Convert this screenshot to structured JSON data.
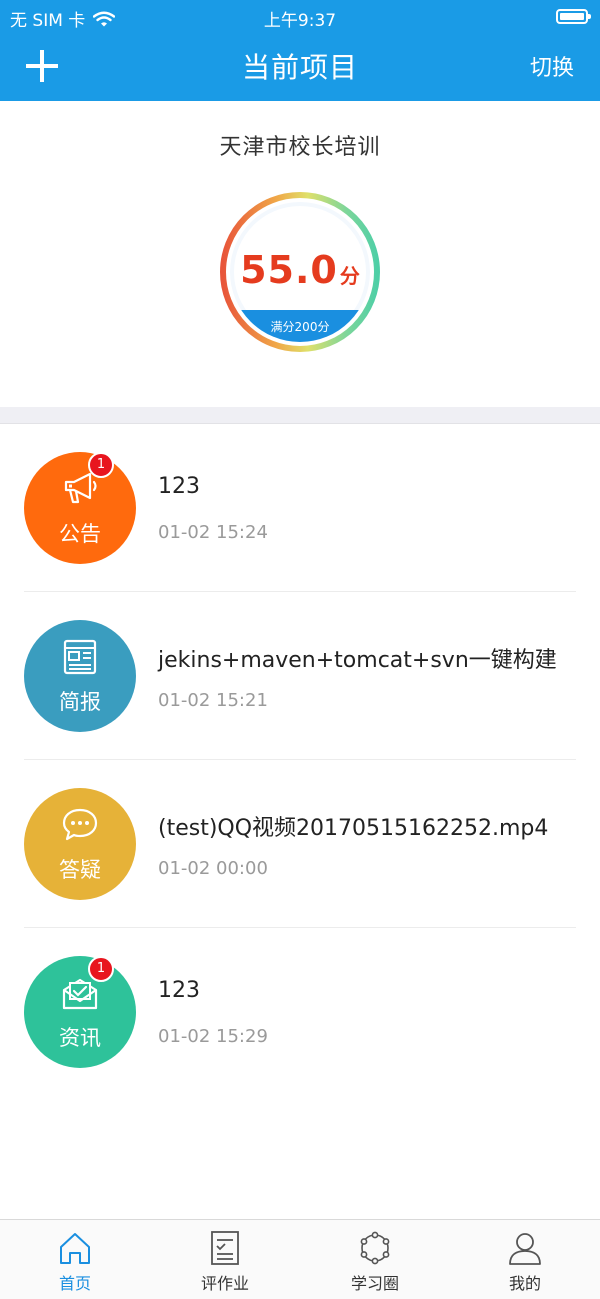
{
  "status_bar": {
    "carrier": "无 SIM 卡",
    "time": "上午9:37"
  },
  "nav": {
    "title": "当前项目",
    "switch_label": "切换",
    "add_icon": "plus-icon"
  },
  "project": {
    "name": "天津市校长培训",
    "score": "55.0",
    "score_unit": "分",
    "full_score_label": "满分200分",
    "score_fraction": 0.275
  },
  "colors": {
    "nav_bg": "#1a9be6",
    "score_red": "#e53b1e",
    "announcement": "#ff6a0d",
    "report": "#3a9dbf",
    "qa": "#e6b238",
    "news": "#2ec29a",
    "badge": "#e8151e",
    "tab_active": "#1a8fe0"
  },
  "items": [
    {
      "category": "公告",
      "icon": "megaphone-icon",
      "badge": "1",
      "title": "123",
      "time": "01-02 15:24"
    },
    {
      "category": "简报",
      "icon": "newspaper-icon",
      "badge": "",
      "title": "jekins+maven+tomcat+svn一键构建",
      "time": "01-02 15:21"
    },
    {
      "category": "答疑",
      "icon": "chat-bubble-icon",
      "badge": "",
      "title": "(test)QQ视频20170515162252.mp4",
      "time": "01-02 00:00"
    },
    {
      "category": "资讯",
      "icon": "mail-icon",
      "badge": "1",
      "title": "123",
      "time": "01-02 15:29"
    }
  ],
  "tabs": [
    {
      "label": "首页",
      "icon": "home-icon",
      "active": true
    },
    {
      "label": "评作业",
      "icon": "document-icon",
      "active": false
    },
    {
      "label": "学习圈",
      "icon": "circle-network-icon",
      "active": false
    },
    {
      "label": "我的",
      "icon": "user-icon",
      "active": false
    }
  ]
}
